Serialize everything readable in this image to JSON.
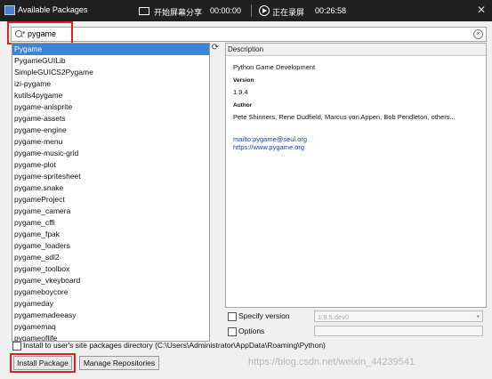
{
  "window": {
    "title": "Available Packages",
    "close_glyph": "✕"
  },
  "recording_bar": {
    "share_label": "开始屏幕分享",
    "share_time": "00:00:00",
    "status_label": "正在录屏",
    "record_time": "00:26:58"
  },
  "search": {
    "value": "pygame",
    "caret": "▾",
    "clear_glyph": "×"
  },
  "packages": {
    "selected_index": 0,
    "items": [
      "Pygame",
      "PygameGUILib",
      "SimpleGUICS2Pygame",
      "izi-pygame",
      "kutils4pygame",
      "pygame-anisprite",
      "pygame-assets",
      "pygame-engine",
      "pygame-menu",
      "pygame-music-grid",
      "pygame-plot",
      "pygame-spritesheet",
      "pygame.snake",
      "pygameProject",
      "pygame_camera",
      "pygame_cffi",
      "pygame_fpak",
      "pygame_loaders",
      "pygame_sdl2",
      "pygame_toolbox",
      "pygame_vkeyboard",
      "pygameboycore",
      "pygameday",
      "pygamemadeeasy",
      "pygamemaq",
      "pygameoflife"
    ]
  },
  "refresh_glyph": "⟳",
  "description": {
    "header": "Description",
    "summary": "Python Game Development",
    "version_label": "Version",
    "version": "1.9.4",
    "author_label": "Author",
    "authors": "Pete Shinners, Rene Dudfield, Marcus von Appen, Bob Pendleton, others...",
    "email": "mailto:pygame@seul.org",
    "url": "https://www.pygame.org"
  },
  "options": {
    "specify_version_label": "Specify version",
    "version_value": "1.9.5.dev0",
    "chevron_glyph": "▾",
    "options_label": "Options",
    "install_user_label": "Install to user's site packages directory (C:\\Users\\Administrator\\AppData\\Roaming\\Python)"
  },
  "buttons": {
    "install": "Install Package",
    "manage": "Manage Repositories"
  },
  "watermark": "https://blog.csdn.net/weixin_44239541"
}
